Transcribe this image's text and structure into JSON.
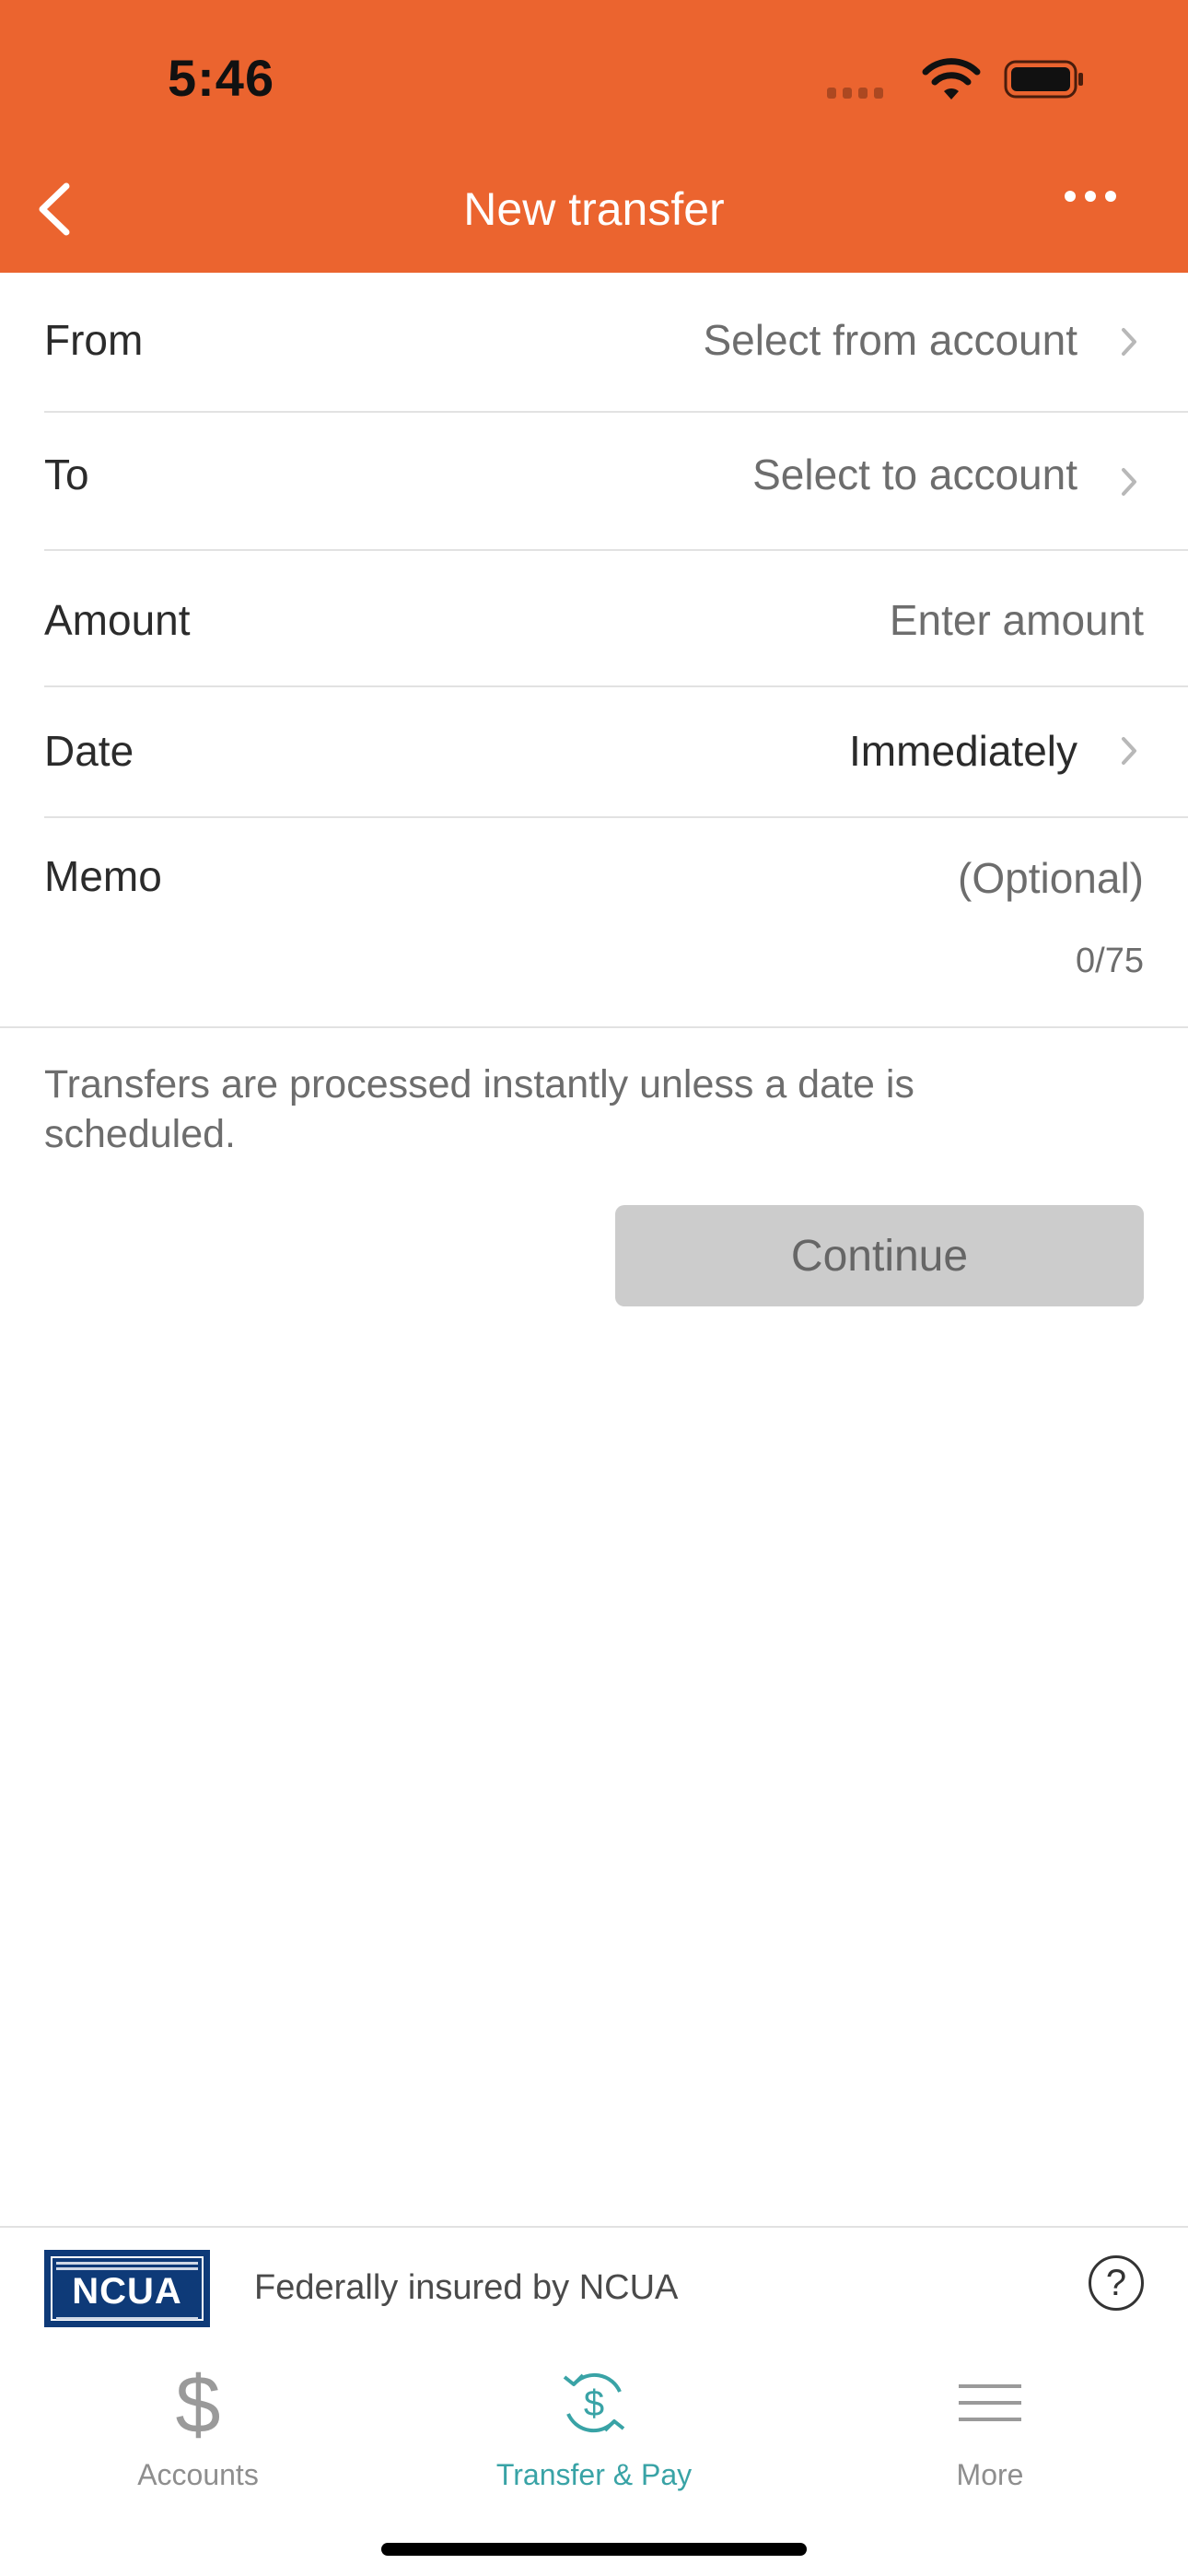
{
  "status_bar": {
    "time": "5:46"
  },
  "nav": {
    "title": "New transfer"
  },
  "form": {
    "from": {
      "label": "From",
      "value": "Select from account"
    },
    "to": {
      "label": "To",
      "value": "Select to account"
    },
    "amount": {
      "label": "Amount",
      "placeholder": "Enter amount"
    },
    "date": {
      "label": "Date",
      "value": "Immediately"
    },
    "memo": {
      "label": "Memo",
      "placeholder": "(Optional)",
      "counter": "0/75"
    }
  },
  "note": "Transfers are processed instantly unless a date is scheduled.",
  "continue_label": "Continue",
  "footer": {
    "logo_text": "NCUA",
    "text": "Federally insured by NCUA",
    "help_symbol": "?"
  },
  "tabs": [
    {
      "label": "Accounts",
      "icon": "dollar-icon",
      "active": false
    },
    {
      "label": "Transfer & Pay",
      "icon": "transfer-dollar-icon",
      "active": true
    },
    {
      "label": "More",
      "icon": "hamburger-icon",
      "active": false
    }
  ],
  "colors": {
    "brand": "#EB642F",
    "accent": "#39A3A6",
    "disabled_button": "#CCCCCC",
    "ncua_blue": "#0E3A78"
  }
}
